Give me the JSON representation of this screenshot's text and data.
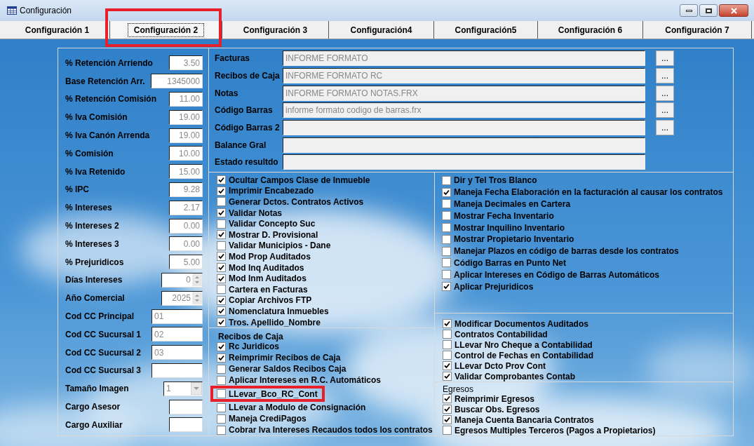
{
  "window": {
    "title": "Configuración"
  },
  "tabs": [
    {
      "label": "Configuración 1",
      "selected": false
    },
    {
      "label": "Configuración 2",
      "selected": true
    },
    {
      "label": "Configuración 3",
      "selected": false
    },
    {
      "label": "Configuración4",
      "selected": false
    },
    {
      "label": "Configuración5",
      "selected": false
    },
    {
      "label": "Configuración 6",
      "selected": false
    },
    {
      "label": "Configuración 7",
      "selected": false
    }
  ],
  "left_fields": [
    {
      "label": "% Retención Arriendo",
      "value": "3.50",
      "kind": "number"
    },
    {
      "label": "Base Retención Arr.",
      "value": "1345000",
      "kind": "wide"
    },
    {
      "label": "% Retención Comisión",
      "value": "11.00",
      "kind": "number"
    },
    {
      "label": "% Iva Comisión",
      "value": "19.00",
      "kind": "number"
    },
    {
      "label": "% Iva Canón Arrenda",
      "value": "19.00",
      "kind": "number"
    },
    {
      "label": "% Comisión",
      "value": "10.00",
      "kind": "number"
    },
    {
      "label": "% Iva Retenido",
      "value": "15.00",
      "kind": "number"
    },
    {
      "label": "% IPC",
      "value": "9.28",
      "kind": "number"
    },
    {
      "label": "% Intereses",
      "value": "2.17",
      "kind": "number"
    },
    {
      "label": "% Intereses 2",
      "value": "0.00",
      "kind": "number"
    },
    {
      "label": "% Intereses 3",
      "value": "0.00",
      "kind": "number"
    },
    {
      "label": "% Prejuridicos",
      "value": "5.00",
      "kind": "number"
    },
    {
      "label": "Días Intereses",
      "value": "0",
      "kind": "spinner"
    },
    {
      "label": "Año Comercial",
      "value": "2025",
      "kind": "spinner"
    },
    {
      "label": "Cod CC Principal",
      "value": "01",
      "kind": "code"
    },
    {
      "label": "Cod CC Sucursal 1",
      "value": "02",
      "kind": "code"
    },
    {
      "label": "Cod CC Sucursal 2",
      "value": "03",
      "kind": "code"
    },
    {
      "label": "Cod CC Sucursal 3",
      "kind": "code"
    },
    {
      "label": "Tamaño Imagen",
      "value": "1",
      "kind": "combo"
    },
    {
      "label": "Cargo Asesor",
      "kind": "number"
    },
    {
      "label": "Cargo Auxiliar",
      "kind": "number"
    }
  ],
  "reports": [
    {
      "label": "Facturas",
      "value": "INFORME FORMATO",
      "browse": "..."
    },
    {
      "label": "Recibos de Caja",
      "value": "INFORME FORMATO RC",
      "browse": "..."
    },
    {
      "label": "Notas",
      "value": "INFORME FORMATO NOTAS.FRX",
      "browse": "..."
    },
    {
      "label": "Código Barras",
      "value": "informe formato codigo de barras.frx",
      "browse": "..."
    },
    {
      "label": "Código Barras 2",
      "browse": "..."
    },
    {
      "label": "Balance Gral"
    },
    {
      "label": "Estado resultdo"
    }
  ],
  "options_a": [
    {
      "label": "Ocultar Campos Clase de Inmueble",
      "checked": true
    },
    {
      "label": "Imprimir Encabezado",
      "checked": true
    },
    {
      "label": "Generar Dctos. Contratos Activos",
      "checked": false
    },
    {
      "label": "Validar Notas",
      "checked": true
    },
    {
      "label": "Validar Concepto Suc",
      "checked": false
    },
    {
      "label": "Mostrar D. Provisional",
      "checked": true
    },
    {
      "label": "Validar Municipios - Dane",
      "checked": false
    },
    {
      "label": "Mod Prop Auditados",
      "checked": true
    },
    {
      "label": "Mod Inq Auditados",
      "checked": true
    },
    {
      "label": "Mod Inm Auditados",
      "checked": true
    },
    {
      "label": "Cartera en Facturas",
      "checked": false
    },
    {
      "label": "Copiar Archivos FTP",
      "checked": true
    },
    {
      "label": "Nomenclatura Inmuebles",
      "checked": true
    },
    {
      "label": "Tros. Apellido_Nombre",
      "checked": true
    }
  ],
  "recibos": {
    "title": "Recibos de Caja",
    "items": [
      {
        "label": "Rc Juridicos",
        "checked": true
      },
      {
        "label": "Reimprimir Recibos de Caja",
        "checked": true
      },
      {
        "label": "Generar Saldos Recibos Caja",
        "checked": false
      },
      {
        "label": "Aplicar Intereses en R.C. Automáticos",
        "checked": false
      },
      {
        "label": "LLevar_Bco_RC_Cont",
        "checked": false,
        "highlighted": true
      },
      {
        "label": "LLevar a Modulo de Consignación",
        "checked": false
      },
      {
        "label": "Maneja CrediPagos",
        "checked": false
      },
      {
        "label": "Cobrar Iva Intereses Recaudos todos los contratos",
        "checked": false
      }
    ]
  },
  "options_b": [
    {
      "label": "Dir y Tel Tros Blanco",
      "checked": false
    },
    {
      "label": "Maneja Fecha Elaboración en la facturación al causar los contratos",
      "checked": true
    },
    {
      "label": "Maneja Decimales en Cartera",
      "checked": false
    },
    {
      "label": "Mostrar Fecha Inventario",
      "checked": false
    },
    {
      "label": "Mostrar Inquilino Inventario",
      "checked": false
    },
    {
      "label": "Mostrar Propietario Inventario",
      "checked": false
    },
    {
      "label": "Manejar Plazos en código de barras desde los contratos",
      "checked": false
    },
    {
      "label": "Código Barras en Punto Net",
      "checked": false
    },
    {
      "label": "Aplicar Intereses en Código de Barras Automáticos",
      "checked": false
    },
    {
      "label": "Aplicar Prejuridicos",
      "checked": true
    }
  ],
  "options_c": [
    {
      "label": "Modificar Documentos Auditados",
      "checked": true
    },
    {
      "label": "Contratos Contabilidad",
      "checked": false
    },
    {
      "label": "LLevar Nro Cheque a Contabilidad",
      "checked": false
    },
    {
      "label": "Control de Fechas en Contabilidad",
      "checked": false
    },
    {
      "label": "LLevar Dcto Prov Cont",
      "checked": true
    },
    {
      "label": "Validar Comprobantes Contab",
      "checked": true
    }
  ],
  "egresos": {
    "title": "Egresos",
    "items": [
      {
        "label": "Reimprimir Egresos",
        "checked": true
      },
      {
        "label": "Buscar Obs. Egresos",
        "checked": true
      },
      {
        "label": "Maneja Cuenta Bancaria Contratos",
        "checked": true
      },
      {
        "label": "Egresos Multiples Terceros (Pagos a Propietarios)",
        "checked": false
      }
    ]
  }
}
